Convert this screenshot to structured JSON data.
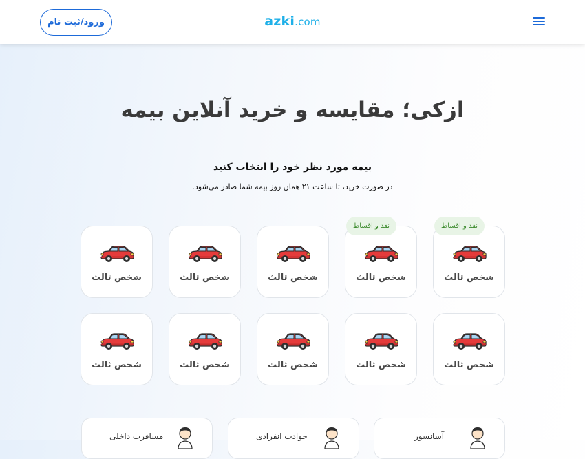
{
  "header": {
    "login_label": "ورود/ثبت نام",
    "logo_name": "azki",
    "logo_tld": ".com",
    "menu_icon": "hamburger-icon"
  },
  "hero": {
    "title": "ازکی؛ مقایسه و خرید آنلاین بیمه",
    "subtitle": "بیمه مورد نظر خود را انتخاب کنید",
    "note": "در صورت خرید، تا ساعت ۲۱ همان روز بیمه شما صادر می‌شود."
  },
  "products": {
    "icon": "car-icon",
    "badge_color": "#3d8b2e",
    "row1": [
      {
        "label": "شخص ثالث",
        "badge": "نقد و اقساط"
      },
      {
        "label": "شخص ثالث",
        "badge": "نقد و اقساط"
      },
      {
        "label": "شخص ثالث",
        "badge": ""
      },
      {
        "label": "شخص ثالث",
        "badge": ""
      },
      {
        "label": "شخص ثالث",
        "badge": ""
      }
    ],
    "row2": [
      {
        "label": "شخص ثالث"
      },
      {
        "label": "شخص ثالث"
      },
      {
        "label": "شخص ثالث"
      },
      {
        "label": "شخص ثالث"
      },
      {
        "label": "شخص ثالث"
      }
    ]
  },
  "more": {
    "icon": "person-icon",
    "items": [
      {
        "label": "آسانسور"
      },
      {
        "label": "حوادث انفرادی"
      },
      {
        "label": "مسافرت داخلی"
      }
    ]
  }
}
